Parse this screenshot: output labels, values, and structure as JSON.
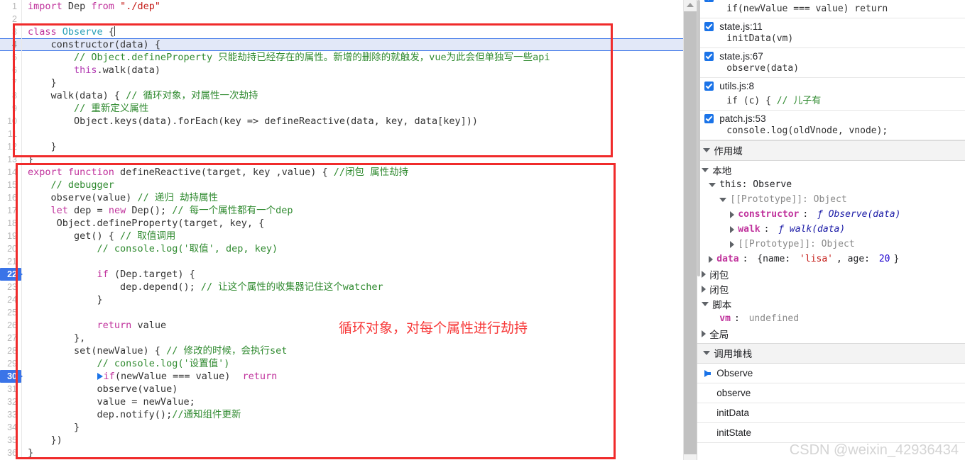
{
  "editor": {
    "lines": [
      {
        "n": "1",
        "tokens": [
          {
            "t": "import ",
            "c": "kw"
          },
          {
            "t": "Dep",
            "c": "plain"
          },
          {
            "t": " from ",
            "c": "kw"
          },
          {
            "t": "\"./dep\"",
            "c": "str"
          }
        ]
      },
      {
        "n": "2",
        "tokens": []
      },
      {
        "n": "3",
        "tokens": [
          {
            "t": "class ",
            "c": "kw"
          },
          {
            "t": "Observe",
            "c": "cls"
          },
          {
            "t": " {",
            "c": "plain"
          }
        ]
      },
      {
        "n": "4",
        "tokens": [
          {
            "t": "    constructor",
            "c": "plain"
          },
          {
            "t": "(data) ",
            "c": "plain"
          },
          {
            "t": "{",
            "c": "plain"
          }
        ],
        "exec": true
      },
      {
        "n": "5",
        "tokens": [
          {
            "t": "        // Object.defineProperty 只能劫持已经存在的属性。新增的删除的就触发，vue为此会但单独写一些api",
            "c": "cmt"
          }
        ]
      },
      {
        "n": "6",
        "tokens": [
          {
            "t": "        ",
            "c": "plain"
          },
          {
            "t": "this",
            "c": "kw2"
          },
          {
            "t": ".walk(data)",
            "c": "plain"
          }
        ]
      },
      {
        "n": "7",
        "tokens": [
          {
            "t": "    }",
            "c": "plain"
          }
        ]
      },
      {
        "n": "8",
        "tokens": [
          {
            "t": "    walk(data) { ",
            "c": "plain"
          },
          {
            "t": "// 循环对象，对属性一次劫持",
            "c": "cmt"
          }
        ]
      },
      {
        "n": "9",
        "tokens": [
          {
            "t": "        ",
            "c": "plain"
          },
          {
            "t": "// 重新定义属性",
            "c": "cmt"
          }
        ]
      },
      {
        "n": "10",
        "tokens": [
          {
            "t": "        Object.keys(data).forEach(key => defineReactive(data, key, data[key]))",
            "c": "plain"
          }
        ]
      },
      {
        "n": "11",
        "tokens": []
      },
      {
        "n": "12",
        "tokens": [
          {
            "t": "    }",
            "c": "plain"
          }
        ]
      },
      {
        "n": "13",
        "tokens": [
          {
            "t": "}",
            "c": "plain"
          }
        ]
      },
      {
        "n": "14",
        "tokens": [
          {
            "t": "export function ",
            "c": "kw"
          },
          {
            "t": "defineReactive",
            "c": "plain"
          },
          {
            "t": "(target, key ,value) { ",
            "c": "plain"
          },
          {
            "t": "//闭包 属性劫持",
            "c": "cmt"
          }
        ]
      },
      {
        "n": "15",
        "tokens": [
          {
            "t": "    ",
            "c": "plain"
          },
          {
            "t": "// debugger",
            "c": "cmt"
          }
        ]
      },
      {
        "n": "16",
        "tokens": [
          {
            "t": "    observe(value) ",
            "c": "plain"
          },
          {
            "t": "// 递归 劫持属性",
            "c": "cmt"
          }
        ]
      },
      {
        "n": "17",
        "tokens": [
          {
            "t": "    ",
            "c": "plain"
          },
          {
            "t": "let",
            "c": "kw"
          },
          {
            "t": " dep = ",
            "c": "plain"
          },
          {
            "t": "new",
            "c": "kw"
          },
          {
            "t": " Dep(); ",
            "c": "plain"
          },
          {
            "t": "// 每一个属性都有一个dep",
            "c": "cmt"
          }
        ]
      },
      {
        "n": "18",
        "tokens": [
          {
            "t": "     Object.defineProperty(target, key, {",
            "c": "plain"
          }
        ]
      },
      {
        "n": "19",
        "tokens": [
          {
            "t": "        get() { ",
            "c": "plain"
          },
          {
            "t": "// 取值调用",
            "c": "cmt"
          }
        ]
      },
      {
        "n": "20",
        "tokens": [
          {
            "t": "            ",
            "c": "plain"
          },
          {
            "t": "// console.log('取值', dep, key)",
            "c": "cmt"
          }
        ]
      },
      {
        "n": "21",
        "tokens": []
      },
      {
        "n": "22",
        "tokens": [
          {
            "t": "            ",
            "c": "plain"
          },
          {
            "t": "if",
            "c": "kw"
          },
          {
            "t": " (Dep.target) {",
            "c": "plain"
          }
        ],
        "bp": true,
        "lnActive": true
      },
      {
        "n": "23",
        "tokens": [
          {
            "t": "                dep.depend(); ",
            "c": "plain"
          },
          {
            "t": "// 让这个属性的收集器记住这个watcher",
            "c": "cmt"
          }
        ]
      },
      {
        "n": "24",
        "tokens": [
          {
            "t": "            }",
            "c": "plain"
          }
        ]
      },
      {
        "n": "25",
        "tokens": []
      },
      {
        "n": "26",
        "tokens": [
          {
            "t": "            ",
            "c": "plain"
          },
          {
            "t": "return",
            "c": "kw"
          },
          {
            "t": " value",
            "c": "plain"
          }
        ]
      },
      {
        "n": "27",
        "tokens": [
          {
            "t": "        },",
            "c": "plain"
          }
        ]
      },
      {
        "n": "28",
        "tokens": [
          {
            "t": "        set(newValue) { ",
            "c": "plain"
          },
          {
            "t": "// 修改的时候，会执行set",
            "c": "cmt"
          }
        ]
      },
      {
        "n": "29",
        "tokens": [
          {
            "t": "            ",
            "c": "plain"
          },
          {
            "t": "// console.log('设置值')",
            "c": "cmt"
          }
        ]
      },
      {
        "n": "30",
        "tokens": [
          {
            "t": "            ",
            "c": "plain"
          },
          {
            "t": "__TRI_SOLID__",
            "c": "marker"
          },
          {
            "t": "if",
            "c": "kw"
          },
          {
            "t": "(newValue === value) ",
            "c": "plain"
          },
          {
            "t": "__TRI_HOLLOW__",
            "c": "marker"
          },
          {
            "t": "return",
            "c": "kw"
          }
        ],
        "bp": true,
        "lnActive": true
      },
      {
        "n": "31",
        "tokens": [
          {
            "t": "            observe(value)",
            "c": "plain"
          }
        ]
      },
      {
        "n": "32",
        "tokens": [
          {
            "t": "            value = newValue;",
            "c": "plain"
          }
        ]
      },
      {
        "n": "33",
        "tokens": [
          {
            "t": "            dep.notify();",
            "c": "plain"
          },
          {
            "t": "//通知组件更新",
            "c": "cmt"
          }
        ]
      },
      {
        "n": "34",
        "tokens": [
          {
            "t": "        }",
            "c": "plain"
          }
        ]
      },
      {
        "n": "35",
        "tokens": [
          {
            "t": "    })",
            "c": "plain"
          }
        ]
      },
      {
        "n": "36",
        "tokens": [
          {
            "t": "}",
            "c": "plain"
          }
        ]
      }
    ],
    "annotation_note": "循环对象，对每个属性进行劫持"
  },
  "sidebar": {
    "breakpoints": [
      {
        "file": "",
        "code": "if(newValue === value) return",
        "checked": true,
        "partial": true
      },
      {
        "file": "state.js:11",
        "code": "initData(vm)",
        "checked": true
      },
      {
        "file": "state.js:67",
        "code": "observe(data)",
        "checked": true
      },
      {
        "file": "utils.js:8",
        "code_plain": "if (c) { ",
        "code_comment": "// 儿子有",
        "checked": true
      },
      {
        "file": "patch.js:53",
        "code": "console.log(oldVnode, vnode);",
        "checked": true
      }
    ],
    "scope_header": "作用域",
    "scope": {
      "local_label": "本地",
      "this_label": "this: Observe",
      "proto1": "[[Prototype]]: Object",
      "constructor_key": "constructor",
      "constructor_val": "ƒ Observe(data)",
      "walk_key": "walk",
      "walk_val": "ƒ walk(data)",
      "proto2": "[[Prototype]]: Object",
      "data_key": "data",
      "data_val_open": "{name: ",
      "data_val_str": "'lisa'",
      "data_val_mid": ", age: ",
      "data_val_num": "20",
      "data_val_close": "}",
      "closure1": "闭包",
      "closure2": "闭包",
      "script_label": "脚本",
      "vm_key": "vm",
      "vm_val": "undefined",
      "global_label": "全局"
    },
    "callstack_header": "调用堆栈",
    "callstack": [
      {
        "name": "Observe",
        "current": true
      },
      {
        "name": "observe",
        "current": false
      },
      {
        "name": "initData",
        "current": false
      },
      {
        "name": "initState",
        "current": false
      }
    ]
  },
  "watermark": "CSDN @weixin_42936434"
}
